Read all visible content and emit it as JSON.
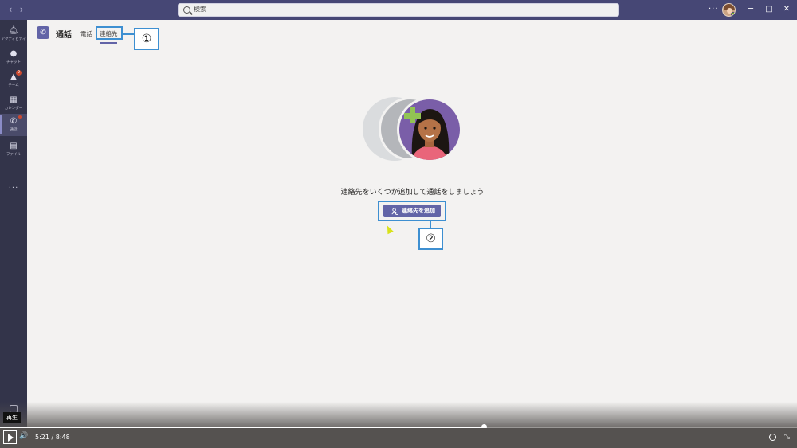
{
  "titlebar": {
    "back_icon": "chevron-left-icon",
    "forward_icon": "chevron-right-icon",
    "search_placeholder": "検索",
    "more_label": "···",
    "minimize_label": "─",
    "maximize_label": "□",
    "close_label": "✕"
  },
  "rail": {
    "items": [
      {
        "label": "アクティビティ",
        "icon": "bell-icon"
      },
      {
        "label": "チャット",
        "icon": "chat-icon"
      },
      {
        "label": "チーム",
        "icon": "teams-icon",
        "badge": "9"
      },
      {
        "label": "カレンダー",
        "icon": "calendar-icon"
      },
      {
        "label": "通話",
        "icon": "phone-icon",
        "active": true
      },
      {
        "label": "ファイル",
        "icon": "file-icon"
      }
    ],
    "more_label": "···"
  },
  "header": {
    "title": "通話",
    "tabs": [
      {
        "label": "電話"
      },
      {
        "label": "連絡先",
        "selected": true
      }
    ]
  },
  "annotations": {
    "one": "①",
    "two": "②"
  },
  "main": {
    "message": "連絡先をいくつか追加して通話をしましょう",
    "add_button": "連絡先を追加"
  },
  "player": {
    "tooltip": "再生",
    "current_time": "5:21",
    "separator": "/",
    "duration": "8:48",
    "progress": 0.607,
    "volume_label": "🔊"
  },
  "colors": {
    "titlebar": "#464775",
    "rail": "#33344a",
    "accent": "#6264a7",
    "annotation": "#3d8fd1",
    "plus": "#92c353"
  }
}
